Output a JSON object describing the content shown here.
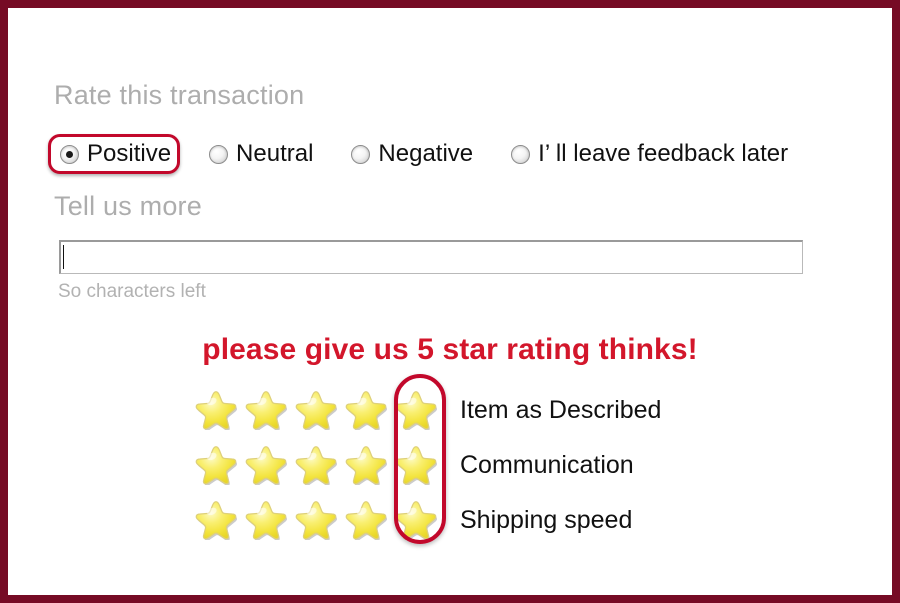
{
  "form": {
    "rate_heading": "Rate this transaction",
    "tell_heading": "Tell us more",
    "chars_left": "So characters left",
    "comment_value": "",
    "comment_placeholder": "",
    "callout": "please give us 5 star rating thinks!",
    "radio_options": [
      {
        "label": "Positive",
        "checked": true,
        "highlighted": true
      },
      {
        "label": "Neutral",
        "checked": false,
        "highlighted": false
      },
      {
        "label": "Negative",
        "checked": false,
        "highlighted": false
      },
      {
        "label": "I’  ll leave feedback later",
        "checked": false,
        "highlighted": false
      }
    ],
    "star_rows": [
      {
        "label": "Item as Described",
        "filled": 5,
        "total": 5
      },
      {
        "label": "Communication",
        "filled": 5,
        "total": 5
      },
      {
        "label": "Shipping speed",
        "filled": 5,
        "total": 5
      }
    ]
  },
  "colors": {
    "page_border": "#760b25",
    "highlight_red": "#c2082b",
    "callout_red": "#d3162b",
    "heading_gray": "#adadad",
    "hint_gray": "#b2b2b2",
    "star_yellow": "#f7e94a",
    "text_black": "#111111"
  },
  "icons": {
    "star": "star-icon",
    "radio_selected": "radio-selected-icon",
    "radio_empty": "radio-empty-icon"
  }
}
